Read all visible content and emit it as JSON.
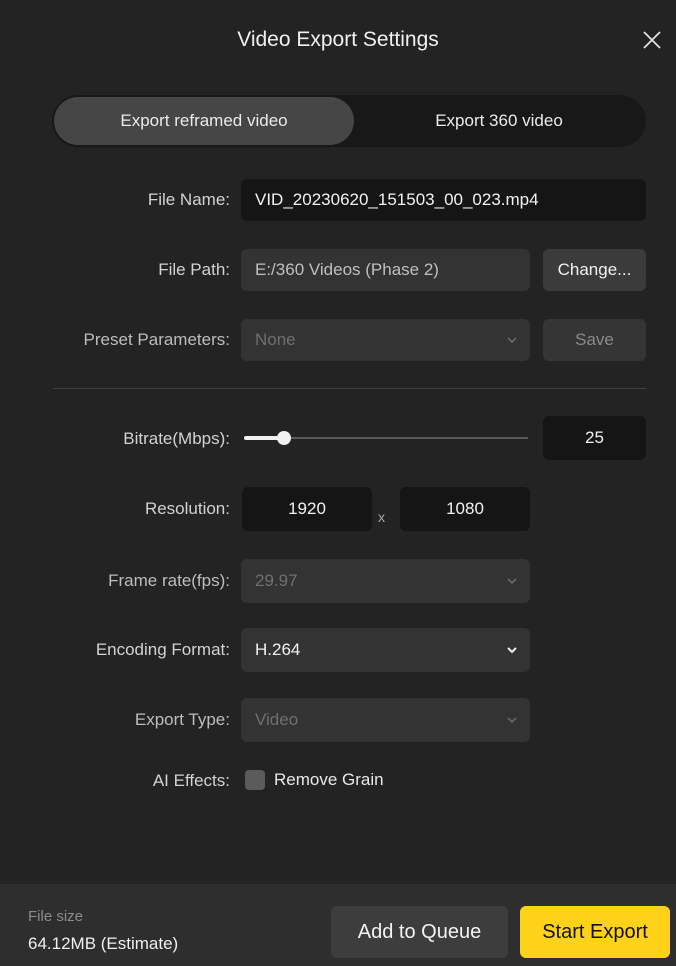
{
  "title": "Video Export Settings",
  "tabs": [
    {
      "label": "Export reframed video",
      "active": true
    },
    {
      "label": "Export 360 video",
      "active": false
    }
  ],
  "file_name": {
    "label": "File Name:",
    "value": "VID_20230620_151503_00_023.mp4"
  },
  "file_path": {
    "label": "File Path:",
    "value": "E:/360 Videos (Phase 2)",
    "button": "Change..."
  },
  "preset": {
    "label": "Preset Parameters:",
    "value": "None",
    "button": "Save"
  },
  "bitrate": {
    "label": "Bitrate(Mbps):",
    "value": "25",
    "fraction": 0.14
  },
  "resolution": {
    "label": "Resolution:",
    "width": "1920",
    "separator": "x",
    "height": "1080"
  },
  "frame_rate": {
    "label": "Frame rate(fps):",
    "value": "29.97"
  },
  "encoding": {
    "label": "Encoding Format:",
    "value": "H.264"
  },
  "export_type": {
    "label": "Export Type:",
    "value": "Video"
  },
  "ai_effects": {
    "label": "AI Effects:",
    "option": "Remove Grain",
    "checked": false
  },
  "footer": {
    "file_size_label": "File size",
    "file_size_value": "64.12MB (Estimate)",
    "queue_button": "Add to Queue",
    "export_button": "Start Export"
  },
  "colors": {
    "accent": "#ffd21a",
    "background": "#232323",
    "field": "#333333"
  },
  "icons": {
    "close": "close-icon",
    "dropdown": "chevron-down-icon"
  }
}
